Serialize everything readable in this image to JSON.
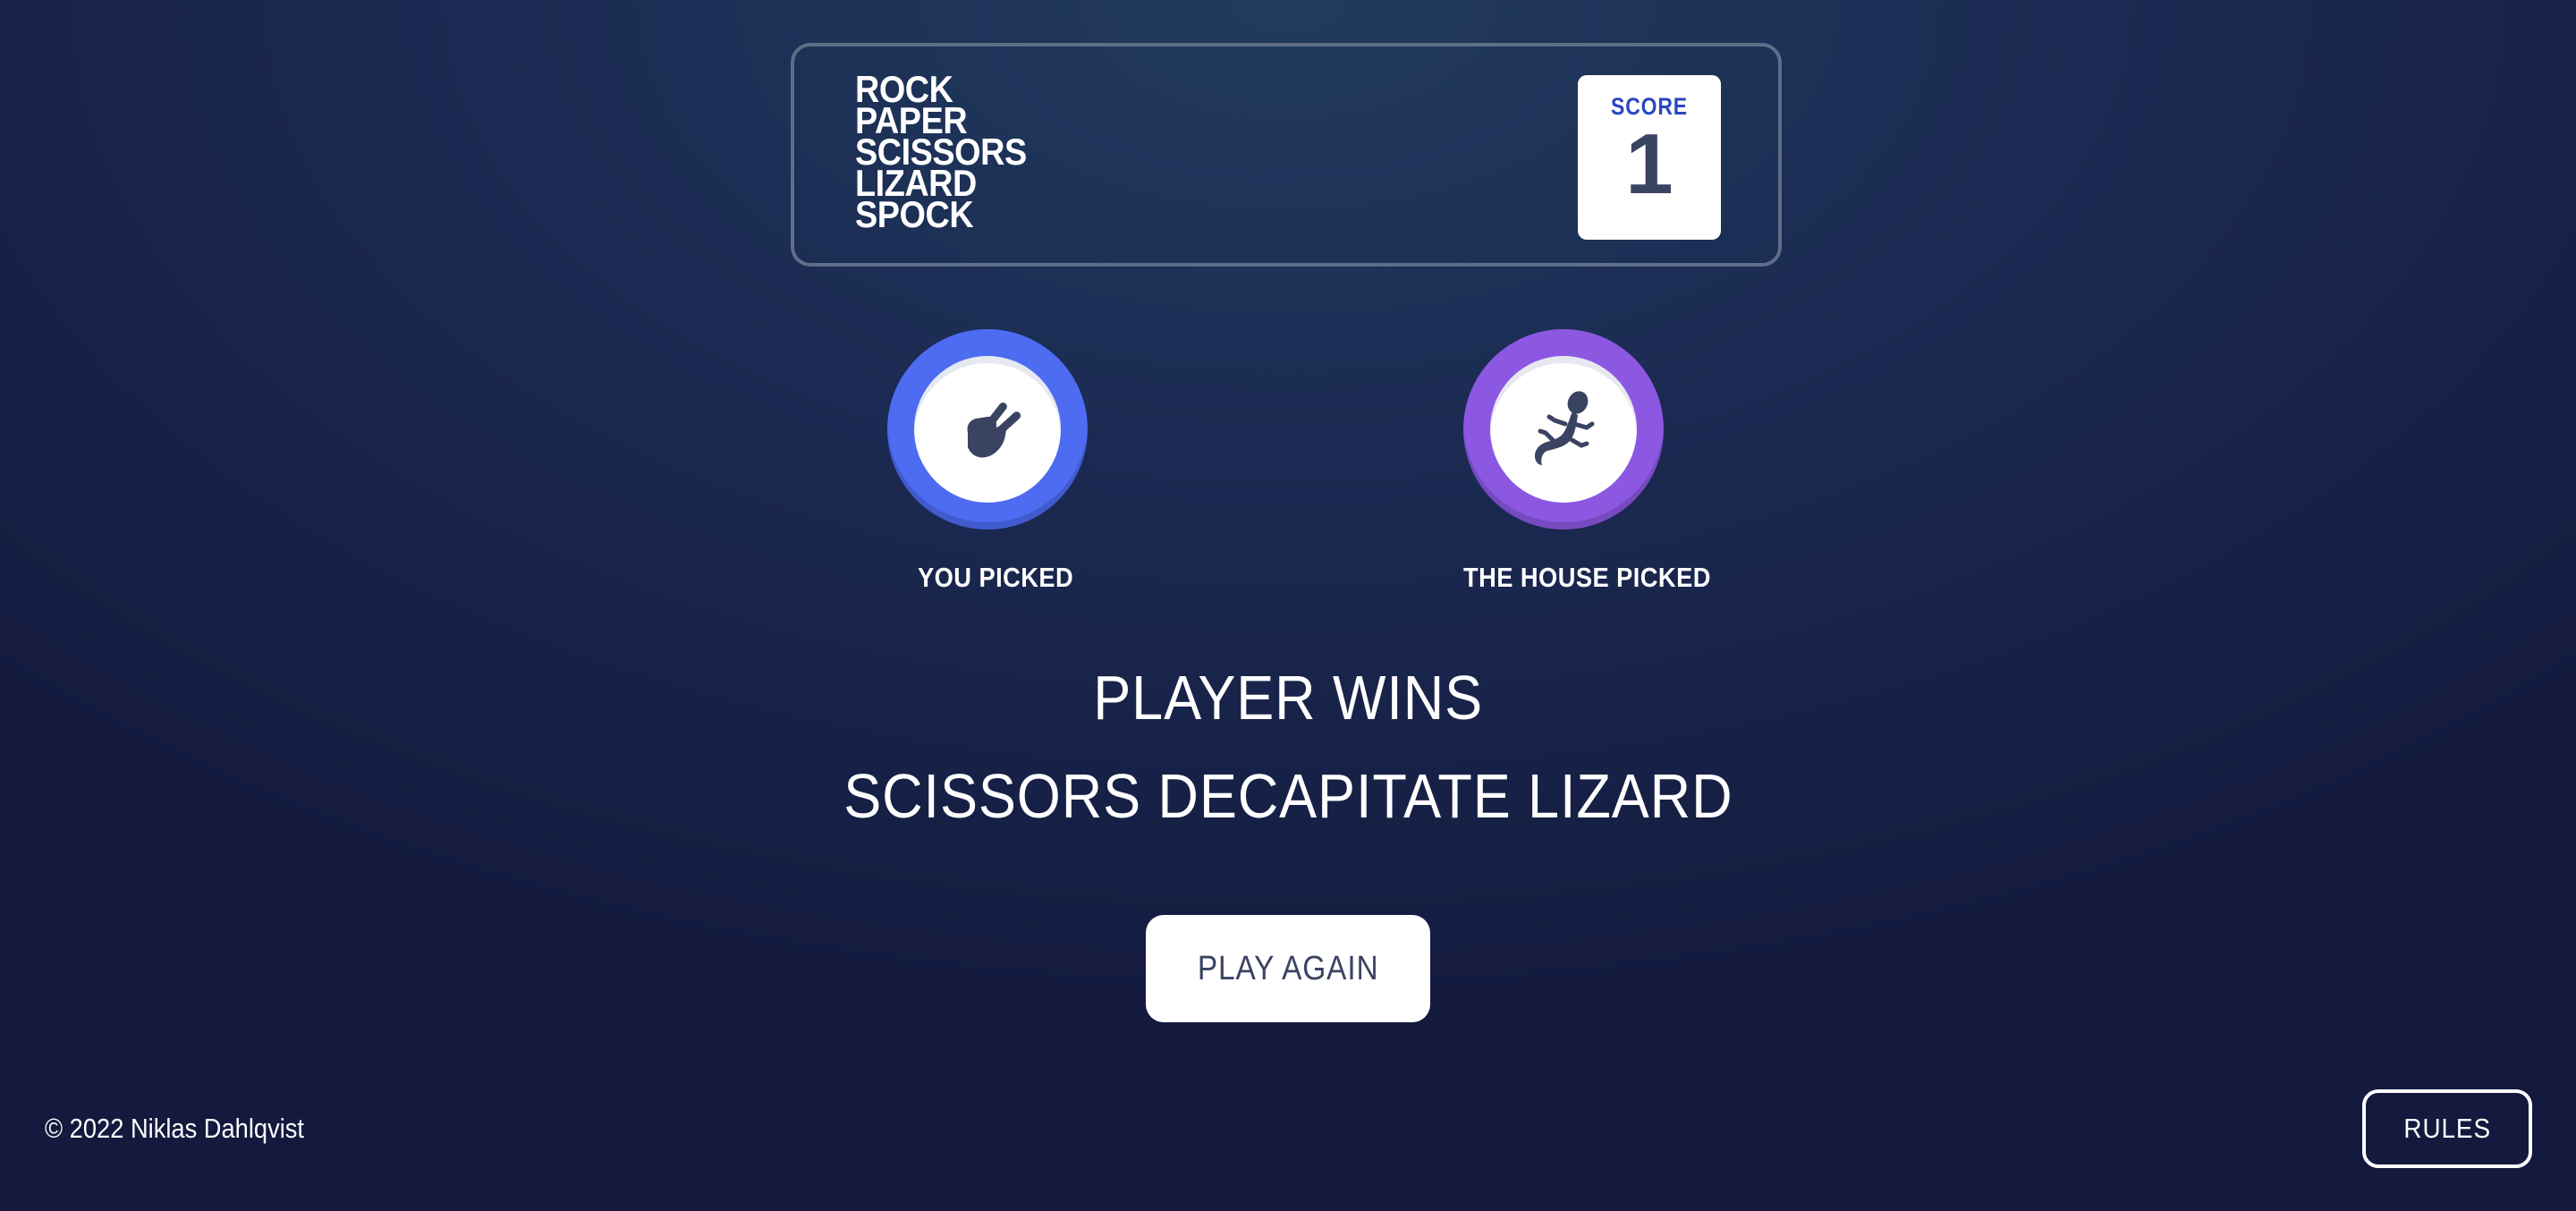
{
  "header": {
    "logo_lines": [
      "ROCK",
      "PAPER",
      "SCISSORS",
      "LIZARD",
      "SPOCK"
    ],
    "score_label": "SCORE",
    "score_value": "1"
  },
  "picks": {
    "player": {
      "label": "YOU PICKED",
      "choice": "scissors",
      "icon": "scissors-icon",
      "color": "#4d6cf2"
    },
    "house": {
      "label": "THE HOUSE PICKED",
      "choice": "lizard",
      "icon": "lizard-icon",
      "color": "#8c58e2"
    }
  },
  "result": {
    "title": "PLAYER WINS",
    "reason": "SCISSORS DECAPITATE LIZARD",
    "play_again_label": "PLAY AGAIN"
  },
  "footer": {
    "copyright": "© 2022 Niklas Dahlqvist",
    "rules_label": "RULES"
  }
}
